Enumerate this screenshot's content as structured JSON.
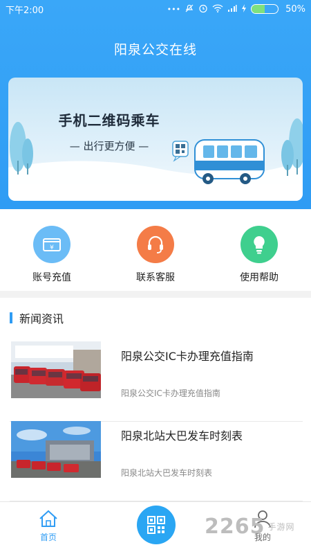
{
  "status_bar": {
    "time": "下午2:00",
    "battery_percent_label": "50%",
    "battery_level": 0.5
  },
  "app": {
    "title": "阳泉公交在线"
  },
  "banner": {
    "headline": "手机二维码乘车",
    "subtitle": "— 出行更方便 —"
  },
  "actions": [
    {
      "label": "账号充值",
      "icon": "wallet-icon",
      "color": "#6bbcf6"
    },
    {
      "label": "联系客服",
      "icon": "headset-icon",
      "color": "#f47c47"
    },
    {
      "label": "使用帮助",
      "icon": "lightbulb-icon",
      "color": "#3fcf8e"
    }
  ],
  "news": {
    "section_title": "新闻资讯",
    "items": [
      {
        "headline": "阳泉公交IC卡办理充值指南",
        "summary": "阳泉公交IC卡办理充值指南"
      },
      {
        "headline": "阳泉北站大巴发车时刻表",
        "summary": "阳泉北站大巴发车时刻表"
      }
    ]
  },
  "tabbar": {
    "home_label": "首页",
    "mine_label": "我的"
  },
  "watermark": {
    "number": "2265",
    "suffix": "手游网"
  },
  "colors": {
    "brand": "#2f9cf4",
    "header": "#3aa7f8"
  }
}
